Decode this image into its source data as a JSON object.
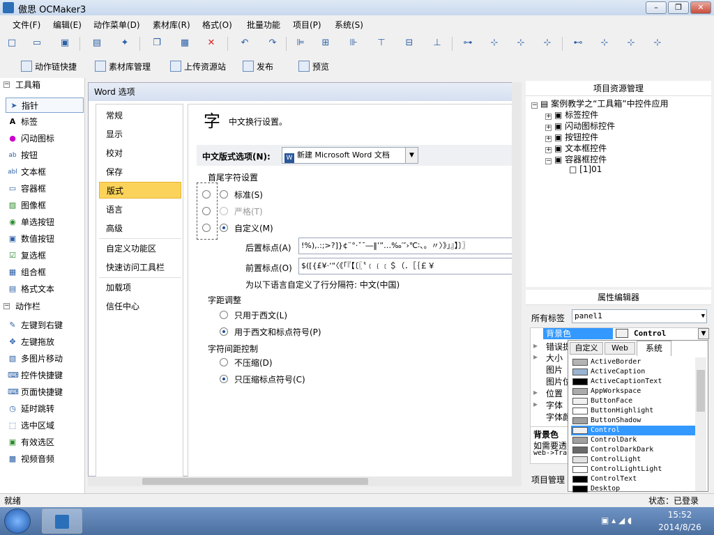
{
  "window": {
    "title": "傲思 OCMaker3",
    "btn_min": "–",
    "btn_max": "❐",
    "btn_close": "✕"
  },
  "menu": [
    "文件(F)",
    "编辑(E)",
    "动作菜单(D)",
    "素材库(R)",
    "格式(O)",
    "批量功能",
    "项目(P)",
    "系统(S)"
  ],
  "toolbar2": [
    "动作链快捷",
    "素材库管理",
    "上传资源站",
    "发布",
    "预览"
  ],
  "toolbox": {
    "header": "工具箱",
    "items": [
      "指针",
      "标签",
      "闪动图标",
      "按钮",
      "文本框",
      "容器框",
      "图像框",
      "单选按钮",
      "数值按钮",
      "复选框",
      "组合框",
      "格式文本"
    ],
    "action_header": "动作栏",
    "actions": [
      "左键到右键",
      "左键拖放",
      "多图片移动",
      "控件快捷键",
      "页面快捷键",
      "延时跳转",
      "选中区域",
      "有效选区",
      "视频音频"
    ]
  },
  "dialog": {
    "title": "Word 选项",
    "nav": [
      "常规",
      "显示",
      "校对",
      "保存",
      "版式",
      "语言",
      "高级",
      "自定义功能区",
      "快速访问工具栏",
      "加载项",
      "信任中心"
    ],
    "heading": "中文换行设置。",
    "heading_glyph": "字",
    "format_label": "中文版式选项(N):",
    "format_value": "新建 Microsoft Word 文档",
    "group1": "首尾字符设置",
    "opt_standard": "标准(S)",
    "opt_strict": "严格(T)",
    "opt_custom": "自定义(M)",
    "follow_label": "后置标点(A)",
    "follow_value": "!%),.:;>?]}¢¨°·ˇˉ―‖’”…‰′″›℃∶、。〃〉》」』】〕〗",
    "lead_label": "前置标点(O)",
    "lead_value": "$([{£¥·‘“〈《「『【〔〖〝﹙﹛﹝＄（．［｛￡￥",
    "lang_note": "为以下语言自定义了行分隔符: 中文(中国)",
    "group2": "字距调整",
    "opt_western": "只用于西文(L)",
    "opt_western_punct": "用于西文和标点符号(P)",
    "group3": "字符间距控制",
    "opt_nocompress": "不压缩(D)",
    "opt_compress_punct": "只压缩标点符号(C)"
  },
  "project": {
    "header": "项目资源管理",
    "root": "案例教学之“工具箱”中控件应用",
    "children": [
      "标签控件",
      "闪动图标控件",
      "按钮控件",
      "文本框控件",
      "容器框控件"
    ],
    "leaf": "[1]01"
  },
  "properties": {
    "header": "属性编辑器",
    "all_tags_label": "所有标签",
    "all_tags_value": "panel1",
    "selected_prop": "背景色",
    "selected_value": "Control",
    "props": [
      "错误提",
      "大小",
      "图片",
      "图片位",
      "位置",
      "字体",
      "字体颜"
    ],
    "desc_title": "背景色",
    "desc_line1": "如需要透",
    "desc_line2": "web->Tra",
    "footer_tab": "项目管理"
  },
  "color_picker": {
    "tabs": [
      "自定义",
      "Web",
      "系统"
    ],
    "colors": [
      {
        "name": "ActiveBorder",
        "hex": "#b4b4b4"
      },
      {
        "name": "ActiveCaption",
        "hex": "#99b4d1"
      },
      {
        "name": "ActiveCaptionText",
        "hex": "#000000"
      },
      {
        "name": "AppWorkspace",
        "hex": "#ababab"
      },
      {
        "name": "ButtonFace",
        "hex": "#f0f0f0"
      },
      {
        "name": "ButtonHighlight",
        "hex": "#ffffff"
      },
      {
        "name": "ButtonShadow",
        "hex": "#a0a0a0"
      },
      {
        "name": "Control",
        "hex": "#f0f0f0"
      },
      {
        "name": "ControlDark",
        "hex": "#a0a0a0"
      },
      {
        "name": "ControlDarkDark",
        "hex": "#696969"
      },
      {
        "name": "ControlLight",
        "hex": "#e3e3e3"
      },
      {
        "name": "ControlLightLight",
        "hex": "#ffffff"
      },
      {
        "name": "ControlText",
        "hex": "#000000"
      },
      {
        "name": "Desktop",
        "hex": "#000000"
      }
    ]
  },
  "status": {
    "left": "就绪",
    "right": "状态：已登录"
  },
  "taskbar": {
    "time": "15:52",
    "date": "2014/8/26"
  }
}
